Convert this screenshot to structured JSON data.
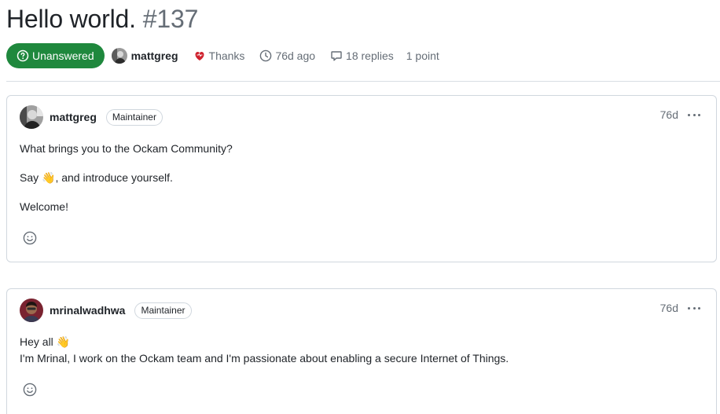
{
  "discussion": {
    "title": "Hello world.",
    "number": "#137",
    "state": "Unanswered",
    "author": "mattgreg",
    "thanks_label": "Thanks",
    "age": "76d ago",
    "replies": "18 replies",
    "points": "1 point"
  },
  "comments": [
    {
      "author": "mattgreg",
      "role": "Maintainer",
      "time": "76d",
      "paragraphs": [
        "What brings you to the Ockam Community?",
        "Say 👋, and introduce yourself.",
        "Welcome!"
      ]
    },
    {
      "author": "mrinalwadhwa",
      "role": "Maintainer",
      "time": "76d",
      "lines": [
        "Hey all 👋",
        "I'm Mrinal, I work on the Ockam team and I'm passionate about enabling a secure Internet of Things."
      ]
    }
  ],
  "colors": {
    "state_green": "#1f883d",
    "muted": "#656d76",
    "border": "#d0d7de",
    "heart": "#cf222e"
  },
  "icons": [
    "question-circle-icon",
    "heart-icon",
    "clock-icon",
    "comment-icon",
    "kebab-icon",
    "smiley-icon"
  ]
}
